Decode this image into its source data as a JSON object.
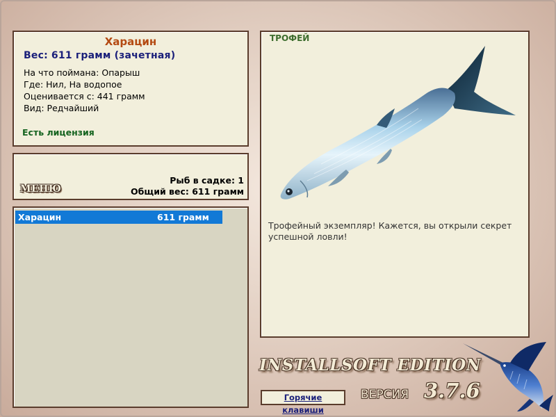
{
  "fish_info": {
    "name": "Харацин",
    "weight_line": "Вес: 611 грамм (зачетная)",
    "bait_line": "На что поймана: Опарыш",
    "place_line": "Где: Нил, На водопое",
    "valued_line": "Оценивается с: 441 грамм",
    "kind_line": "Вид: Редчайший",
    "license": "Есть лицензия"
  },
  "menu": {
    "button_label": "МЕНЮ",
    "fish_count": "Рыб в садке: 1",
    "total_weight": "Общий вес: 611 грамм"
  },
  "catch_list": [
    {
      "name": "Харацин",
      "weight": "611 грамм"
    }
  ],
  "trophy": {
    "label": "ТРОФЕЙ",
    "message": "Трофейный экземпляр! Кажется, вы открыли секрет успешной ловли!"
  },
  "footer": {
    "edition": "INSTALLSOFT EDITION",
    "version_label": "ВЕРСИЯ",
    "version_number": "3.7.6",
    "hotkeys_button": "Горячие клавиши"
  },
  "icons": {
    "fish_image": "fish-image",
    "logo": "marlin-logo-icon"
  },
  "colors": {
    "fish_name": "#b44a12",
    "weight": "#1a1f7a",
    "license": "#14631f",
    "selection": "#1279d6",
    "trophy_label": "#3d6d2e",
    "panel_bg": "#f2efdc",
    "panel_border": "#5a3c2c"
  }
}
